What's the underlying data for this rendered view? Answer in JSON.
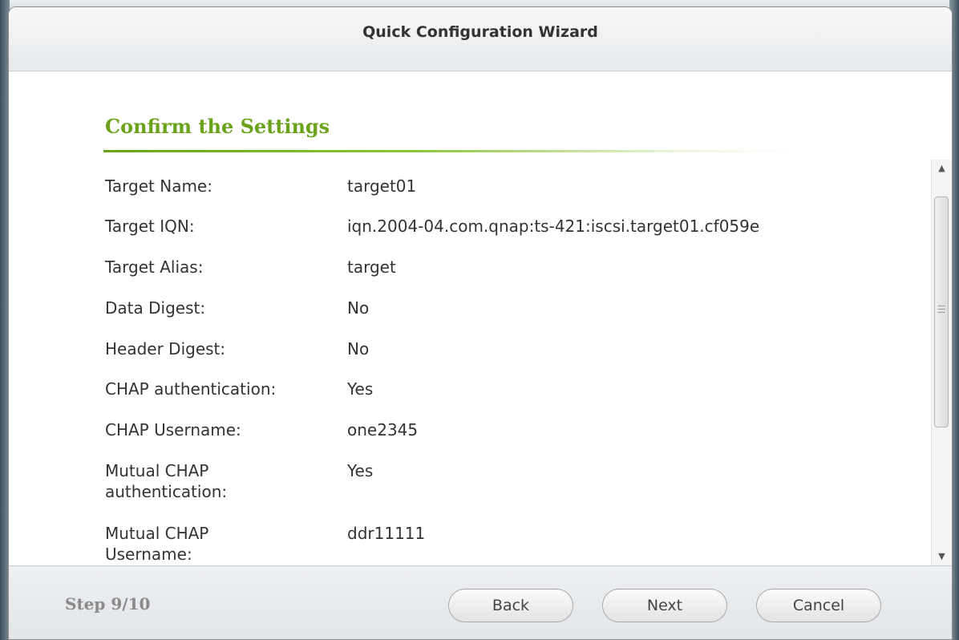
{
  "dialog": {
    "title": "Quick Configuration Wizard",
    "section_heading": "Confirm the Settings"
  },
  "settings": [
    {
      "label": "Target Name:",
      "value": "target01"
    },
    {
      "label": "Target IQN:",
      "value": "iqn.2004-04.com.qnap:ts-421:iscsi.target01.cf059e"
    },
    {
      "label": "Target Alias:",
      "value": "target"
    },
    {
      "label": "Data Digest:",
      "value": "No"
    },
    {
      "label": "Header Digest:",
      "value": "No"
    },
    {
      "label": "CHAP authentication:",
      "value": "Yes"
    },
    {
      "label": "CHAP Username:",
      "value": "one2345"
    },
    {
      "label": "Mutual CHAP authentication:",
      "value": "Yes"
    },
    {
      "label": "Mutual CHAP Username:",
      "value": "ddr11111"
    }
  ],
  "footer": {
    "step": "Step 9/10",
    "back_label": "Back",
    "next_label": "Next",
    "cancel_label": "Cancel"
  },
  "icons": {
    "scroll_up": "scroll-up-arrow-icon",
    "scroll_down": "scroll-down-arrow-icon",
    "scroll_grip": "scroll-grip-icon"
  },
  "colors": {
    "heading": "#6aa21a",
    "text": "#333333",
    "step_text": "#8a8a8a"
  }
}
